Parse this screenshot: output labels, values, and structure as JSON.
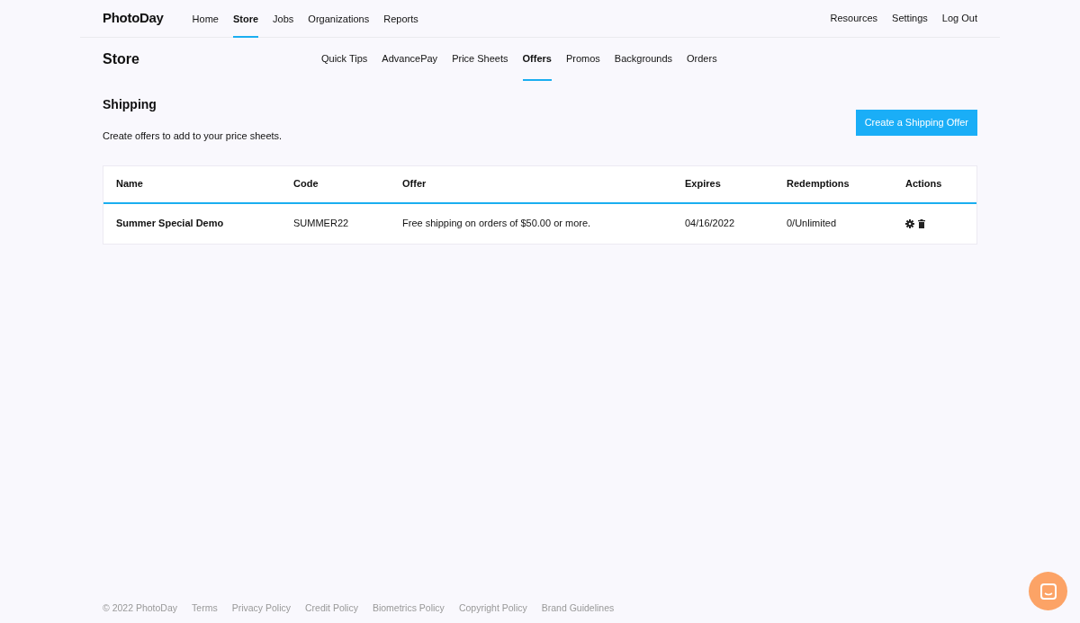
{
  "brand": {
    "name": "PhotoDay"
  },
  "main_nav": [
    {
      "label": "Home",
      "selected": false
    },
    {
      "label": "Store",
      "selected": true
    },
    {
      "label": "Jobs",
      "selected": false
    },
    {
      "label": "Organizations",
      "selected": false
    },
    {
      "label": "Reports",
      "selected": false
    }
  ],
  "right_nav": [
    "Resources",
    "Settings",
    "Log Out"
  ],
  "section_title": "Store",
  "sub_nav": [
    {
      "label": "Quick Tips",
      "selected": false
    },
    {
      "label": "AdvancePay",
      "selected": false
    },
    {
      "label": "Price Sheets",
      "selected": false
    },
    {
      "label": "Offers",
      "selected": true
    },
    {
      "label": "Promos",
      "selected": false
    },
    {
      "label": "Backgrounds",
      "selected": false
    },
    {
      "label": "Orders",
      "selected": false
    }
  ],
  "page": {
    "title": "Shipping",
    "description": "Create offers to add to your price sheets.",
    "button": "Create a Shipping Offer"
  },
  "table": {
    "columns": [
      "Name",
      "Code",
      "Offer",
      "Expires",
      "Redemptions",
      "Actions"
    ],
    "rows": [
      {
        "name": "Summer Special Demo",
        "code": "SUMMER22",
        "offer": "Free shipping on orders of $50.00 or more.",
        "expires": "04/16/2022",
        "redemptions": "0/Unlimited"
      }
    ]
  },
  "footer": [
    "© 2022 PhotoDay",
    "Terms",
    "Privacy Policy",
    "Credit Policy",
    "Biometrics Policy",
    "Copyright Policy",
    "Brand Guidelines"
  ]
}
